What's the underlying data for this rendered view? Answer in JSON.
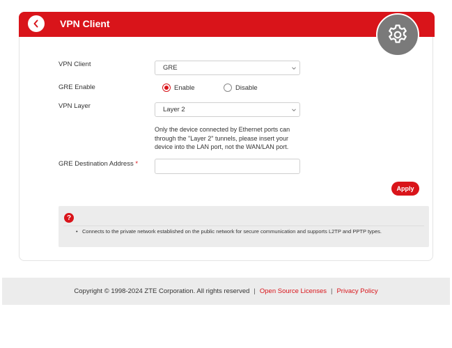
{
  "header": {
    "title": "VPN Client",
    "back_icon": "chevron-left-icon",
    "settings_icon": "gear-icon",
    "accent_color": "#d9141a"
  },
  "form": {
    "vpn_client": {
      "label": "VPN Client",
      "value": "GRE"
    },
    "gre_enable": {
      "label": "GRE Enable",
      "options": [
        {
          "label": "Enable",
          "checked": true
        },
        {
          "label": "Disable",
          "checked": false
        }
      ]
    },
    "vpn_layer": {
      "label": "VPN Layer",
      "value": "Layer 2"
    },
    "note": "Only the device connected by Ethernet ports can through the \"Layer 2\" tunnels, please insert your device into the LAN port, not the WAN/LAN port.",
    "gre_destination": {
      "label": "GRE Destination Address",
      "required_mark": "*",
      "value": ""
    },
    "apply_label": "Apply"
  },
  "help": {
    "icon": "question-icon",
    "items": [
      "Connects to the private network established on the public network for secure communication and supports L2TP and PPTP types."
    ]
  },
  "footer": {
    "copyright": "Copyright © 1998-2024 ZTE Corporation. All rights reserved",
    "separator": "|",
    "links": [
      "Open Source Licenses",
      "Privacy Policy"
    ]
  }
}
